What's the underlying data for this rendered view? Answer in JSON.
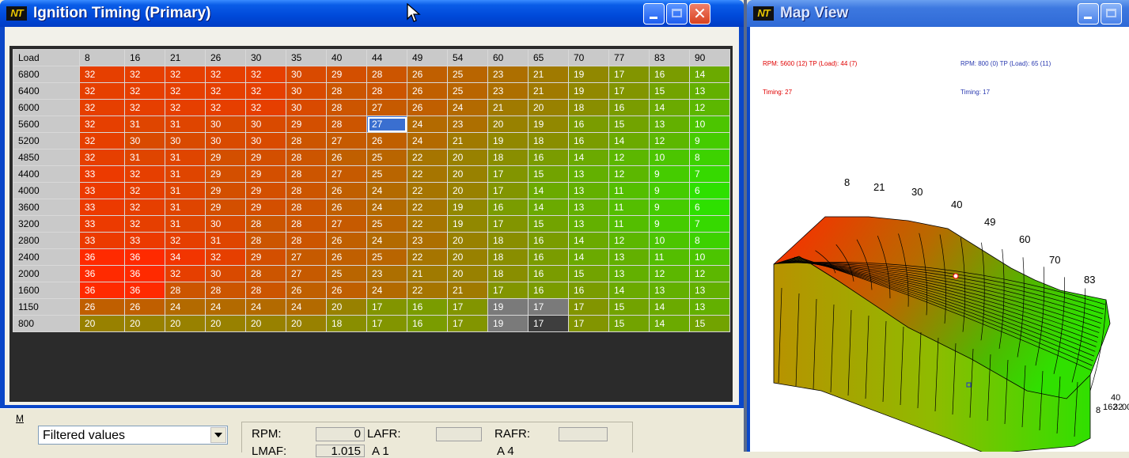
{
  "main_window": {
    "app_icon": "NT",
    "title": "Ignition Timing (Primary)",
    "title_buttons": [
      "minimize-icon",
      "maximize-icon",
      "close-icon"
    ]
  },
  "table": {
    "header": [
      "Load",
      "8",
      "16",
      "21",
      "26",
      "30",
      "35",
      "40",
      "44",
      "49",
      "54",
      "60",
      "65",
      "70",
      "77",
      "83",
      "90"
    ],
    "rows": [
      {
        "load": "6800",
        "values": [
          32,
          32,
          32,
          32,
          32,
          30,
          29,
          28,
          26,
          25,
          23,
          21,
          19,
          17,
          16,
          14
        ]
      },
      {
        "load": "6400",
        "values": [
          32,
          32,
          32,
          32,
          32,
          30,
          28,
          28,
          26,
          25,
          23,
          21,
          19,
          17,
          15,
          13
        ]
      },
      {
        "load": "6000",
        "values": [
          32,
          32,
          32,
          32,
          32,
          30,
          28,
          27,
          26,
          24,
          21,
          20,
          18,
          16,
          14,
          12
        ]
      },
      {
        "load": "5600",
        "values": [
          32,
          31,
          31,
          30,
          30,
          29,
          28,
          27,
          24,
          23,
          20,
          19,
          16,
          15,
          13,
          10
        ]
      },
      {
        "load": "5200",
        "values": [
          32,
          30,
          30,
          30,
          30,
          28,
          27,
          26,
          24,
          21,
          19,
          18,
          16,
          14,
          12,
          9
        ]
      },
      {
        "load": "4850",
        "values": [
          32,
          31,
          31,
          29,
          29,
          28,
          26,
          25,
          22,
          20,
          18,
          16,
          14,
          12,
          10,
          8
        ]
      },
      {
        "load": "4400",
        "values": [
          33,
          32,
          31,
          29,
          29,
          28,
          27,
          25,
          22,
          20,
          17,
          15,
          13,
          12,
          9,
          7
        ]
      },
      {
        "load": "4000",
        "values": [
          33,
          32,
          31,
          29,
          29,
          28,
          26,
          24,
          22,
          20,
          17,
          14,
          13,
          11,
          9,
          6
        ]
      },
      {
        "load": "3600",
        "values": [
          33,
          32,
          31,
          29,
          29,
          28,
          26,
          24,
          22,
          19,
          16,
          14,
          13,
          11,
          9,
          6
        ]
      },
      {
        "load": "3200",
        "values": [
          33,
          32,
          31,
          30,
          28,
          28,
          27,
          25,
          22,
          19,
          17,
          15,
          13,
          11,
          9,
          7
        ]
      },
      {
        "load": "2800",
        "values": [
          33,
          33,
          32,
          31,
          28,
          28,
          26,
          24,
          23,
          20,
          18,
          16,
          14,
          12,
          10,
          8
        ]
      },
      {
        "load": "2400",
        "values": [
          36,
          36,
          34,
          32,
          29,
          27,
          26,
          25,
          22,
          20,
          18,
          16,
          14,
          13,
          11,
          10
        ]
      },
      {
        "load": "2000",
        "values": [
          36,
          36,
          32,
          30,
          28,
          27,
          25,
          23,
          21,
          20,
          18,
          16,
          15,
          13,
          12,
          12
        ]
      },
      {
        "load": "1600",
        "values": [
          36,
          36,
          28,
          28,
          28,
          26,
          26,
          24,
          22,
          21,
          17,
          16,
          16,
          14,
          13,
          13
        ]
      },
      {
        "load": "1150",
        "values": [
          26,
          26,
          24,
          24,
          24,
          24,
          20,
          17,
          16,
          17,
          19,
          17,
          17,
          15,
          14,
          13
        ]
      },
      {
        "load": "800",
        "values": [
          20,
          20,
          20,
          20,
          20,
          20,
          18,
          17,
          16,
          17,
          19,
          17,
          17,
          15,
          14,
          15
        ]
      }
    ],
    "selected_cell": {
      "row": 3,
      "col": 7
    },
    "gray_cells": [
      {
        "row": 14,
        "col": 10
      },
      {
        "row": 14,
        "col": 11
      },
      {
        "row": 15,
        "col": 10
      }
    ],
    "dark_cells": [
      {
        "row": 15,
        "col": 11
      }
    ],
    "color_scale": {
      "high": "#ff2a00",
      "mid": "#a07a00",
      "low": "#2ee000"
    }
  },
  "bottom_panel": {
    "m_button": "M",
    "filter_select": "Filtered values",
    "rpm_label": "RPM:",
    "rpm_value": "0",
    "lafr_label": "LAFR:",
    "lafr_value": "",
    "rafr_label": "RAFR:",
    "rafr_value": "",
    "lmaf_label": "LMAF:",
    "lmaf_value": "1.015",
    "aux1_label": "A 1",
    "aux4_label": "A 4"
  },
  "map_window": {
    "app_icon": "NT",
    "title": "Map View",
    "readout_left": {
      "line1": "RPM: 5600 (12)   TP (Load): 44 (7)",
      "line2": "Timing: 27"
    },
    "readout_right": {
      "line1": "RPM: 800 (0)   TP (Load): 65 (11)",
      "line2": "Timing: 17"
    },
    "axis_labels": [
      "8",
      "21",
      "30",
      "40",
      "49",
      "60",
      "70",
      "83"
    ],
    "corner_labels": {
      "a": "40",
      "b": "8",
      "c": "162",
      "d": "32",
      "e": "00"
    }
  }
}
